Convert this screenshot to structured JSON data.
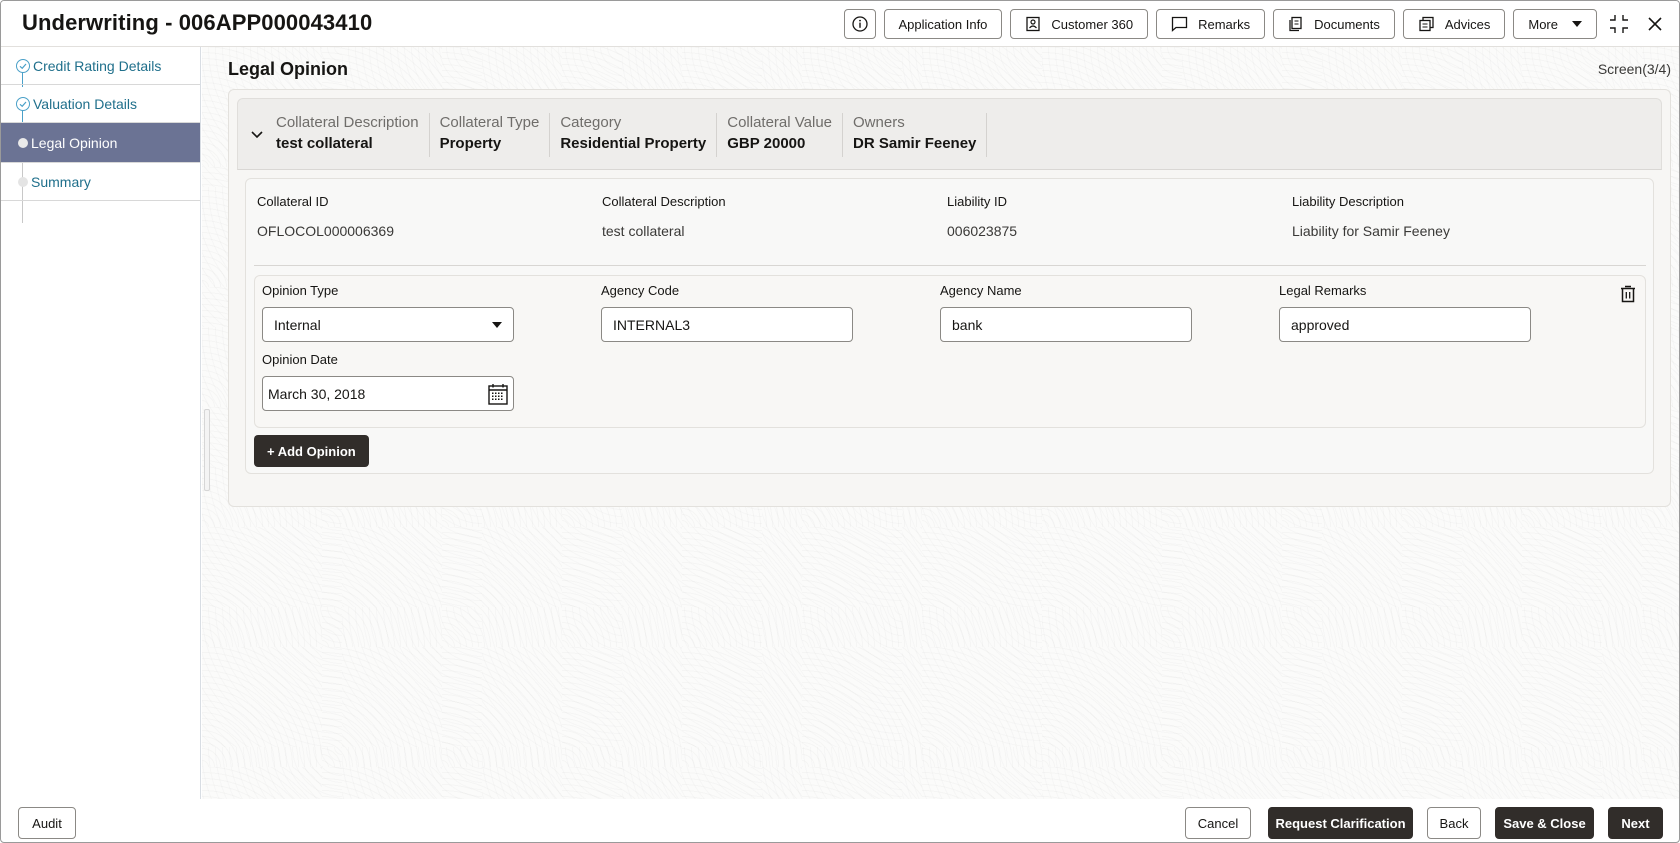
{
  "header": {
    "title": "Underwriting - 006APP000043410",
    "buttons": {
      "info_icon": "info-icon",
      "application_info": "Application Info",
      "customer_360": "Customer 360",
      "remarks": "Remarks",
      "documents": "Documents",
      "advices": "Advices",
      "more": "More"
    }
  },
  "sidebar": {
    "steps": [
      {
        "label": "Credit Rating Details",
        "status": "completed"
      },
      {
        "label": "Valuation Details",
        "status": "completed"
      },
      {
        "label": "Legal Opinion",
        "status": "current"
      },
      {
        "label": "Summary",
        "status": "pending"
      }
    ]
  },
  "main": {
    "page_title": "Legal Opinion",
    "screen_indicator": "Screen(3/4)",
    "collateral_summary": [
      {
        "label": "Collateral Description",
        "value": "test collateral"
      },
      {
        "label": "Collateral Type",
        "value": "Property"
      },
      {
        "label": "Category",
        "value": "Residential Property"
      },
      {
        "label": "Collateral Value",
        "value": "GBP 20000"
      },
      {
        "label": "Owners",
        "value": "DR Samir Feeney"
      }
    ],
    "details": [
      {
        "label": "Collateral ID",
        "value": "OFLOCOL000006369"
      },
      {
        "label": "Collateral Description",
        "value": "test collateral"
      },
      {
        "label": "Liability ID",
        "value": "006023875"
      },
      {
        "label": "Liability Description",
        "value": "Liability for Samir Feeney"
      }
    ],
    "opinion": {
      "opinion_type": {
        "label": "Opinion Type",
        "value": "Internal"
      },
      "agency_code": {
        "label": "Agency Code",
        "value": "INTERNAL3"
      },
      "agency_name": {
        "label": "Agency Name",
        "value": "bank"
      },
      "legal_remarks": {
        "label": "Legal Remarks",
        "value": "approved"
      },
      "opinion_date": {
        "label": "Opinion Date",
        "value": "March 30, 2018"
      }
    },
    "add_opinion_label": "+ Add Opinion"
  },
  "footer": {
    "audit": "Audit",
    "cancel": "Cancel",
    "request_clarification": "Request Clarification",
    "back": "Back",
    "save_close": "Save & Close",
    "next": "Next"
  },
  "colors": {
    "sidebar_active": "#6b7394",
    "step_link": "#1f6f8b",
    "primary_button": "#312d2a"
  }
}
